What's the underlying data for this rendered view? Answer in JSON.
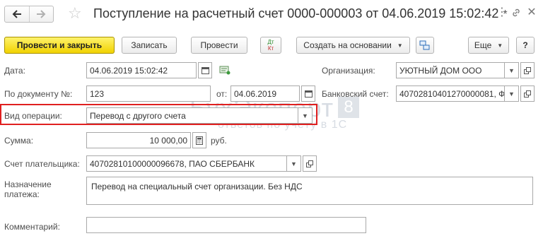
{
  "window": {
    "title": "Поступление на расчетный счет 0000-000003 от 04.06.2019 15:02:42",
    "modified_mark": "*",
    "icons": [
      "back-arrow-icon",
      "forward-arrow-icon",
      "star-icon",
      "more-vertical-icon",
      "link-icon",
      "close-icon"
    ]
  },
  "toolbar": {
    "post_and_close": "Провести и закрыть",
    "save": "Записать",
    "post": "Провести",
    "dt_label": "Дт",
    "kt_label": "Кт",
    "create_based_on": "Создать на основании",
    "more": "Еще",
    "help": "?"
  },
  "form": {
    "date": {
      "label": "Дата:",
      "value": "04.06.2019 15:02:42"
    },
    "organization": {
      "label": "Организация:",
      "value": "УЮТНЫЙ ДОМ ООО"
    },
    "document_no": {
      "label": "По документу №:",
      "value": "123",
      "from_label": "от:",
      "from_value": "04.06.2019"
    },
    "bank_account": {
      "label": "Банковский счет:",
      "value": "40702810401270000081, Ф"
    },
    "operation_type": {
      "label": "Вид операции:",
      "value": "Перевод с другого счета"
    },
    "amount": {
      "label": "Сумма:",
      "value": "10 000,00",
      "currency": "руб."
    },
    "payer_account": {
      "label": "Счет плательщика:",
      "value": "40702810100000096678, ПАО СБЕРБАНК"
    },
    "purpose": {
      "label_line1": "Назначение",
      "label_line2": "платежа:",
      "value": "Перевод на специальный счет организации. Без НДС"
    },
    "comment": {
      "label": "Комментарий:",
      "value": ""
    }
  },
  "watermark": {
    "brand": "БухЭксперт",
    "number": "8",
    "tagline": "ответов по учёту в 1С"
  },
  "colors": {
    "primary_button": "#f5dc14",
    "highlight_border": "#e02020",
    "watermark": "#d7dce3"
  }
}
